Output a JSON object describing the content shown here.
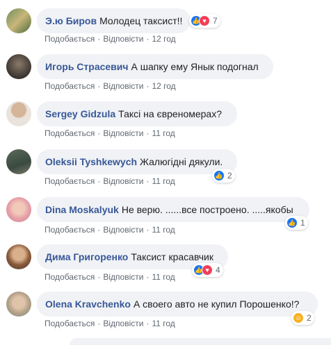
{
  "comments": [
    {
      "author": "Э.ю Биров",
      "text": "Молодец таксист!!",
      "like": "Подобається",
      "reply": "Відповісти",
      "time": "12 год",
      "reactions": [
        "like",
        "love"
      ],
      "count": "7"
    },
    {
      "author": "Игорь Страсевич",
      "text": "А шапку ему Янык подогнал",
      "like": "Подобається",
      "reply": "Відповісти",
      "time": "12 год",
      "reactions": [],
      "count": ""
    },
    {
      "author": "Sergey Gidzula",
      "text": "Таксі на євреномерах?",
      "like": "Подобається",
      "reply": "Відповісти",
      "time": "11 год",
      "reactions": [],
      "count": ""
    },
    {
      "author": "Oleksii Tyshkewych",
      "text": "Жалюгідні дякули.",
      "like": "Подобається",
      "reply": "Відповісти",
      "time": "11 год",
      "reactions": [
        "like"
      ],
      "count": "2"
    },
    {
      "author": "Dina Moskalyuk",
      "text": "Не верю. ......все построено. .....якобы",
      "like": "Подобається",
      "reply": "Відповісти",
      "time": "11 год",
      "reactions": [
        "like"
      ],
      "count": "1"
    },
    {
      "author": "Дима Григоренко",
      "text": "Таксист красавчик",
      "like": "Подобається",
      "reply": "Відповісти",
      "time": "11 год",
      "reactions": [
        "like",
        "love"
      ],
      "count": "4"
    },
    {
      "author": "Olena Kravchenko",
      "text": "А своего авто не купил Порошенко!?",
      "like": "Подобається",
      "reply": "Відповісти",
      "time": "11 год",
      "reactions": [
        "haha"
      ],
      "count": "2"
    }
  ],
  "colors": {
    "author": "#385898",
    "bubble": "#f0f2f5",
    "like": "#1877f2",
    "love": "#f33e58",
    "haha": "#f7b125"
  }
}
